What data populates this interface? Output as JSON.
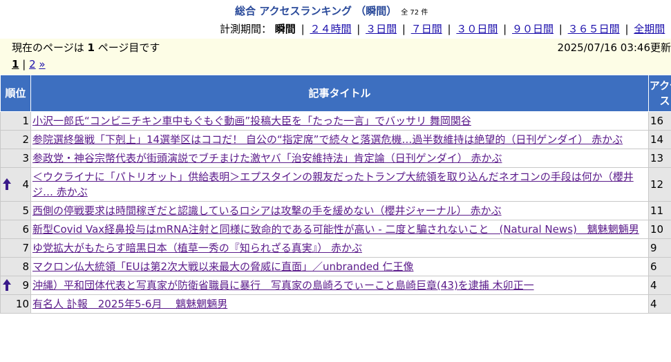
{
  "header": {
    "title": "総合 アクセスランキング （瞬間）",
    "total": "全 72 件",
    "period_label": "計測期間：",
    "period_current": "瞬間",
    "period_links": [
      "２４時間",
      "３日間",
      "７日間",
      "３０日間",
      "９０日間",
      "３６５日間",
      "全期間"
    ]
  },
  "info": {
    "current_page_prefix": "現在のページは",
    "current_page_number": "1",
    "current_page_suffix": "ページ目です",
    "updated": "2025/07/16 03:46更新"
  },
  "pager": {
    "current": "1",
    "sep": "|",
    "next_page": "2",
    "next_arrow": "»"
  },
  "table": {
    "headers": {
      "rank": "順位",
      "title": "記事タイトル",
      "access": "アクセス"
    },
    "rows": [
      {
        "rank": "1",
        "title": "小沢一郎氏“コンビニチキン車中もぐもぐ動画”投稿大臣を「たった一言」でバッサリ 舞岡関谷",
        "access": "16",
        "up": false
      },
      {
        "rank": "2",
        "title": "参院選終盤戦「下剋上」14選挙区はココだ！ 自公の“指定席”で続々と落選危機…過半数維持は絶望的（日刊ゲンダイ） 赤かぶ",
        "access": "14",
        "up": false
      },
      {
        "rank": "3",
        "title": "参政党・神谷宗幣代表が街頭演説でブチまけた激ヤバ「治安維持法」肯定論（日刊ゲンダイ） 赤かぶ",
        "access": "13",
        "up": false
      },
      {
        "rank": "4",
        "title": "＜ウクライナに「パトリオット」供給表明＞エプスタインの親友だったトランプ大統領を取り込んだネオコンの手段は何か（櫻井ジ… 赤かぶ",
        "access": "12",
        "up": true
      },
      {
        "rank": "5",
        "title": "西側の停戦要求は時間稼ぎだと認識しているロシアは攻撃の手を緩めない（櫻井ジャーナル） 赤かぶ",
        "access": "11",
        "up": false
      },
      {
        "rank": "6",
        "title": "新型Covid Vax経鼻投与はmRNA注射と同様に致命的である可能性が高い - 二度と騙されないこと　(Natural News)　魑魅魍魎男",
        "access": "10",
        "up": false
      },
      {
        "rank": "7",
        "title": "ゆ党拡大がもたらす暗黒日本（植草一秀の『知られざる真実』） 赤かぶ",
        "access": "9",
        "up": false
      },
      {
        "rank": "8",
        "title": "マクロン仏大統領「EUは第2次大戦以来最大の脅威に直面」／unbranded 仁王像",
        "access": "6",
        "up": false
      },
      {
        "rank": "9",
        "title": "沖縄）平和団体代表と写真家が防衛省職員に暴行　写真家の島崎ろでぃーこと島崎巨章(43)を逮捕 木卯正一",
        "access": "4",
        "up": true
      },
      {
        "rank": "10",
        "title": "有名人 訃報　2025年5-6月　 魑魅魍魎男",
        "access": "4",
        "up": false
      }
    ]
  },
  "colors": {
    "title_blue": "#2a4a9a",
    "header_bg": "#3d6fc0",
    "info_bg": "#fdfde6",
    "cell_gray": "#e6e6e6",
    "visited_link": "#5a1a8a",
    "link": "#1a0dab",
    "arrow": "#3a1a8a"
  },
  "icons": {
    "rank_up": "up-arrow-icon"
  }
}
